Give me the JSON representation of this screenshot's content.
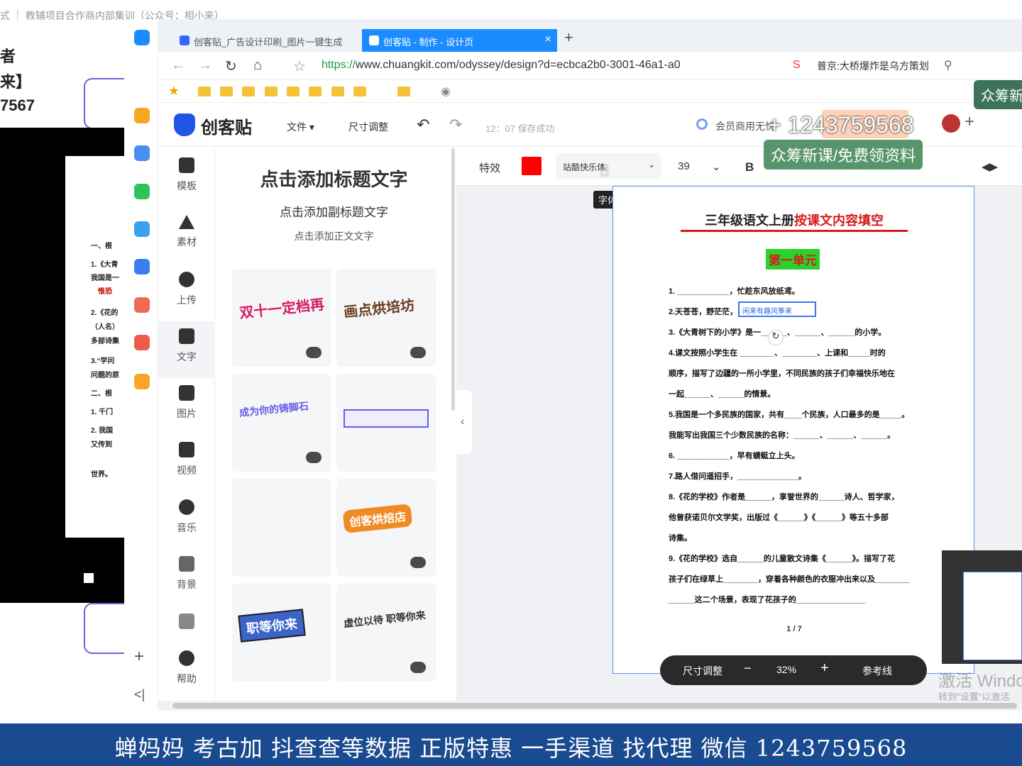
{
  "background_window": {
    "title": "式 ｜ 教辅项目合作商内部集训（公众号：相小来）",
    "doc_lines": [
      "者",
      "来】",
      "7567"
    ],
    "page_lines": [
      "一、根",
      "1.《大青",
      "我国是一",
      "2.《花的",
      "（人名）",
      "多部诗集",
      "3.“学问",
      "问题的原",
      "二、根",
      "1. 千门",
      "2. 我国",
      "又传到",
      "世界。"
    ],
    "page_red": [
      "惟恐"
    ]
  },
  "browser": {
    "tabs": [
      {
        "label": "创客贴_广告设计印刷_图片一键生成"
      },
      {
        "label": "创客贴 - 制作 - 设计页"
      }
    ],
    "tab_close": "×",
    "new_tab": "+",
    "url_prefix": "https://",
    "url_rest": "www.chuangkit.com/odyssey/design?d=ecbca2b0-3001-46a1-a0",
    "news": "普京:大桥爆炸是乌方策划"
  },
  "app": {
    "logo": "创客贴",
    "menu": [
      "文件 ▾",
      "尺寸调整"
    ],
    "save_status": "12：07 保存成功",
    "member": "会员商用无忧"
  },
  "rail": [
    {
      "label": "模板"
    },
    {
      "label": "素材"
    },
    {
      "label": "上传"
    },
    {
      "label": "文字"
    },
    {
      "label": "图片"
    },
    {
      "label": "视频"
    },
    {
      "label": "音乐"
    },
    {
      "label": "背景"
    },
    {
      "label": ""
    },
    {
      "label": "帮助"
    }
  ],
  "panel": {
    "title": "点击添加标题文字",
    "subtitle": "点击添加副标题文字",
    "body": "点击添加正文文字",
    "cards": [
      "双十一定档再",
      "画点烘培坊",
      "成为你的铸脚石",
      "",
      "",
      "创客烘焙店",
      "职等你来",
      "虚位以待 职等你来"
    ]
  },
  "format_bar": {
    "effects": "特效",
    "font_name": "站酷快乐体",
    "font_size": "39",
    "bold": "B",
    "tooltip": "字体",
    "text_color": "#ff0000"
  },
  "document": {
    "title_black": "三年级语文上册",
    "title_red": "按课文内容填空",
    "unit": "第一单元",
    "selected_text": "闲来有趣风筝来",
    "questions": [
      "1. ____________，忙趁东风放纸鸢。",
      "2.天苍苍，野茫茫，",
      "3.《大青树下的小学》是一______、______、______的小学。",
      "4.课文按照小学生在 ________、________、上课和_____时的",
      "顺序，描写了边疆的一所小学里，不同民族的孩子们幸福快乐地在",
      "一起______、______的情景。",
      "5.我国是一个多民族的国家，共有____个民族，人口最多的是_____。",
      "我能写出我国三个少数民族的名称：______、______、______。",
      "6. ____________，早有蜻蜓立上头。",
      "7.路人借问遥招手，______________。",
      "8.《花的学校》作者是______，享誉世界的______诗人、哲学家，",
      "他曾获诺贝尔文学奖，出版过《______》《______》等五十多部",
      "诗集。",
      "9.《花的学校》选自______的儿童散文诗集《______》。描写了花",
      "孩子们在绿草上________，穿着各种颜色的衣服冲出来以及________",
      "______这二个场景，表现了花孩子的________________"
    ],
    "page_indicator": "1 / 7"
  },
  "zoombar": {
    "resize": "尺寸调整",
    "minus": "−",
    "zoom": "32%",
    "plus": "+",
    "guides": "参考线"
  },
  "overlays": {
    "phone": "+ 1243759568",
    "promo": "众筹新课/免费领资料",
    "promo_corner": "众筹新",
    "activate": "激活 Windo",
    "activate_sub": "转到\"设置\"以激活",
    "banner": "蝉妈妈 考古加 抖查查等数据 正版特惠 一手渠道 找代理 微信 1243759568"
  },
  "colors": {
    "accent": "#1a8cff",
    "brand": "#2255e6",
    "banner": "#1a4a8f",
    "highlight_red": "#d71a1a",
    "unit_green": "#2dd12d"
  }
}
